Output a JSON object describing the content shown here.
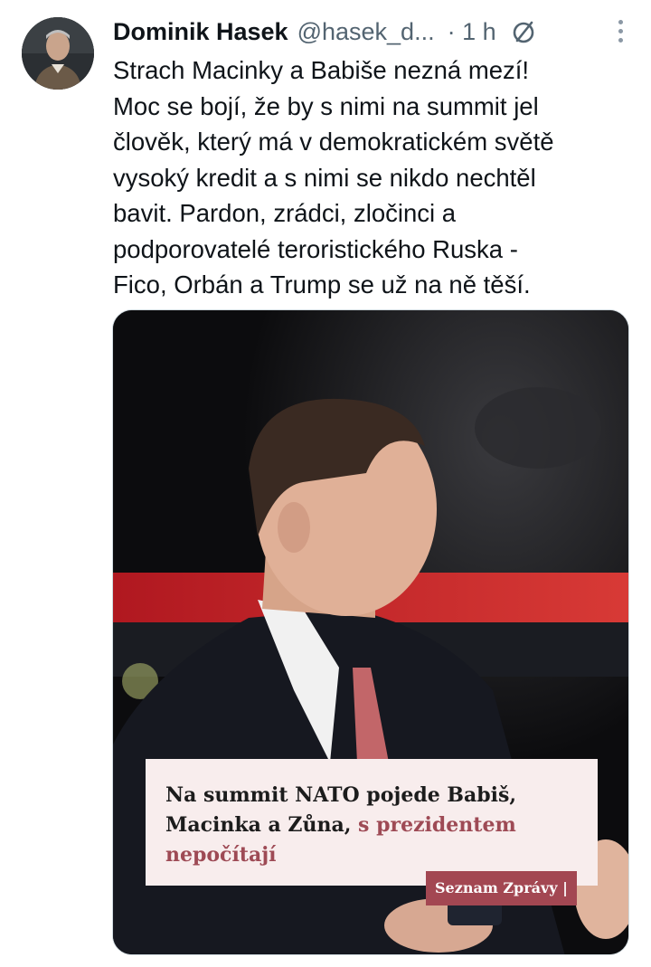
{
  "post": {
    "author_name": "Dominik Hasek",
    "author_handle": "@hasek_d...",
    "time": "· 1 h",
    "text": "Strach Macinky a Babiše nezná mezí!\nMoc se bojí, že by s nimi na summit jel\nčlověk, který má v demokratickém světě\nvysoký kredit a s nimi se nikdo nechtěl\nbavit. Pardon, zrádci, zločinci a\npodporovatelé teroristického Ruska -\nFico, Orbán a Trump se už na ně těší."
  },
  "media": {
    "headline_main": "Na summit NATO pojede Babiš, Macinka a Zůna,",
    "headline_accent": " s prezidentem nepočítají",
    "source": "Seznam Zprávy |"
  },
  "icons": {
    "badge": "no-entry-circle-icon",
    "more": "more-vertical-icon"
  },
  "colors": {
    "text": "#0f1419",
    "secondary": "#536471",
    "headline_accent": "#9e4a55",
    "source_badge": "#a34752",
    "headline_background": "#f8eded"
  }
}
